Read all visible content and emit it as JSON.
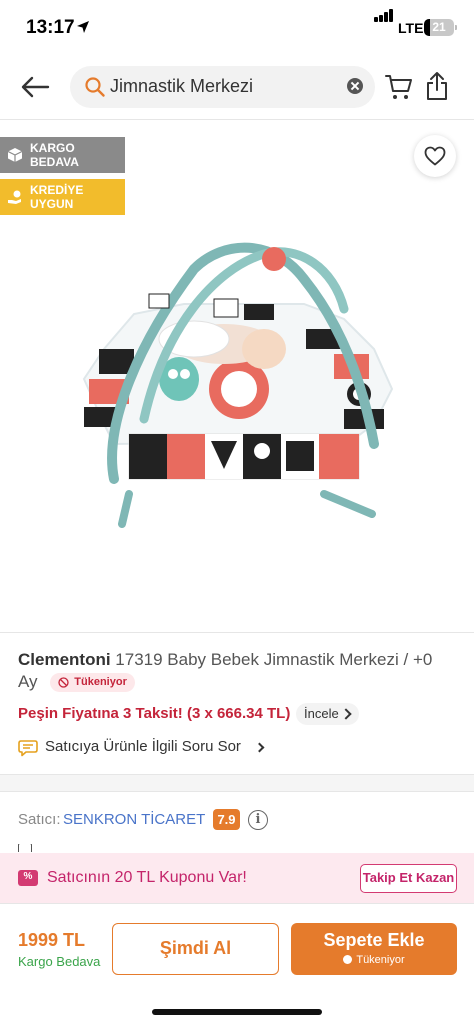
{
  "status_bar": {
    "time": "13:17",
    "network": "LTE",
    "battery": "21",
    "battery_level": 0.21
  },
  "header": {
    "search_text": "Jimnastik Merkezi",
    "icons": [
      "back-arrow-icon",
      "search-icon",
      "clear-icon",
      "cart-icon",
      "share-icon"
    ]
  },
  "gallery": {
    "badges": [
      {
        "label": "KARGO BEDAVA",
        "icon": "box-icon",
        "color": "#8a8a8a"
      },
      {
        "label": "KREDİYE UYGUN",
        "icon": "hand-coin-icon",
        "color": "#f2bc2c"
      }
    ],
    "favorite_icon": "heart-icon"
  },
  "product": {
    "brand": "Clementoni",
    "name": "17319 Baby Bebek Jimnastik Merkezi / +0 Ay",
    "stock_badge": "Tükeniyor",
    "installment_text": "Peşin Fiyatına 3 Taksit! (3 x 666.34 TL)",
    "installment_link": "İncele",
    "question_link": "Satıcıya Ürünle İlgili Soru Sor"
  },
  "seller": {
    "label": "Satıcı:",
    "name": "SENKRON TİCARET",
    "score": "7.9",
    "info_icon": "i"
  },
  "coupon": {
    "text": "Satıcının 20 TL Kuponu Var!",
    "button": "Takip Et Kazan"
  },
  "bottom_bar": {
    "price": "1999 TL",
    "shipping": "Kargo Bedava",
    "buy_now": "Şimdi Al",
    "add_to_cart": "Sepete Ekle",
    "add_to_cart_sub": "Tükeniyor"
  },
  "colors": {
    "accent": "#e57b2c",
    "danger": "#c4243a",
    "link": "#4a74c9",
    "success": "#3aa44a",
    "coupon": "#c4246a"
  }
}
